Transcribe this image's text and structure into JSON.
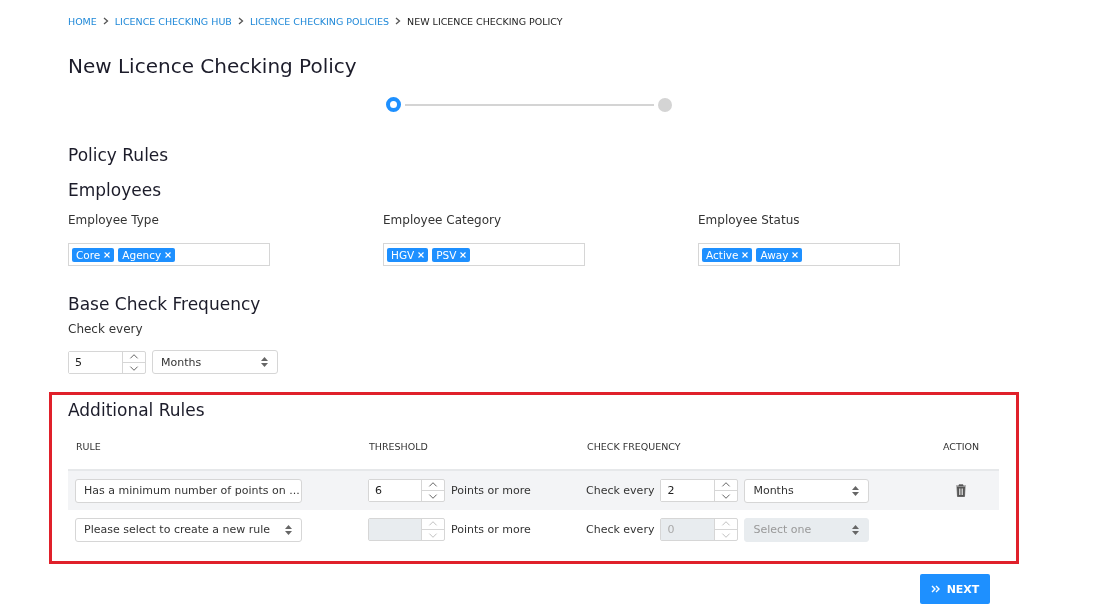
{
  "breadcrumb": [
    {
      "label": "HOME",
      "link": true
    },
    {
      "label": "LICENCE CHECKING HUB",
      "link": true
    },
    {
      "label": "LICENCE CHECKING POLICIES",
      "link": true
    },
    {
      "label": "NEW LICENCE CHECKING POLICY",
      "link": false
    }
  ],
  "title": "New Licence Checking Policy",
  "stepper": [
    {
      "selected": true
    },
    {
      "selected": false
    }
  ],
  "section_title": "Policy Rules",
  "employees": {
    "title": "Employees",
    "fields": [
      {
        "label": "Employee Type",
        "tags": [
          "Core",
          "Agency"
        ]
      },
      {
        "label": "Employee Category",
        "tags": [
          "HGV",
          "PSV"
        ]
      },
      {
        "label": "Employee Status",
        "tags": [
          "Active",
          "Away"
        ]
      }
    ]
  },
  "base_frequency": {
    "title": "Base Check Frequency",
    "label": "Check every",
    "value": "5",
    "unit": "Months"
  },
  "additional_rules": {
    "title": "Additional Rules",
    "columns": [
      "RULE",
      "THRESHOLD",
      "CHECK FREQUENCY",
      "ACTION"
    ],
    "rows": [
      {
        "rule": "Has a minimum number of points on ...",
        "threshold": "6",
        "threshold_suffix": "Points or more",
        "frequency_label": "Check every",
        "frequency": "2",
        "unit": "Months",
        "unit_is_placeholder": false,
        "disabled": false,
        "highlighted": true
      },
      {
        "rule": "Please select to create a new rule",
        "threshold_suffix": "Points or more",
        "frequency_label": "Check every",
        "frequency": "0",
        "unit": "Select one",
        "unit_is_placeholder": true,
        "disabled": true,
        "highlighted": false
      }
    ]
  },
  "next_button": "NEXT"
}
